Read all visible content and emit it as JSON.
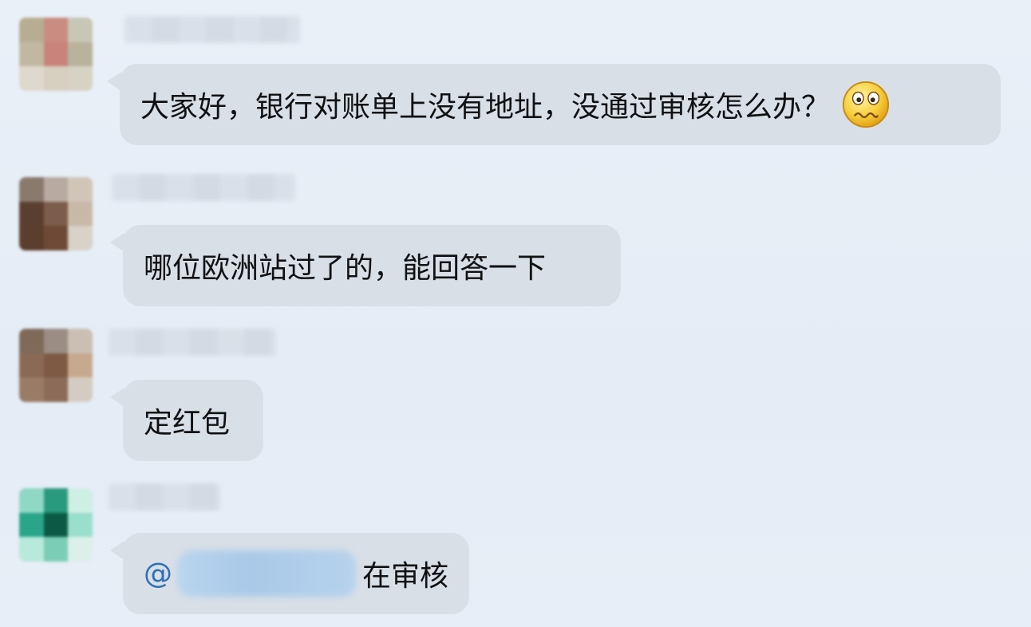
{
  "messages": [
    {
      "text": "大家好，银行对账单上没有地址，没通过审核怎么办？",
      "emoji": "worried-face-icon"
    },
    {
      "text": "哪位欧洲站过了的，能回答一下"
    },
    {
      "text": "定红包"
    },
    {
      "mention_symbol": "@",
      "text": "在审核"
    }
  ],
  "colors": {
    "background": "#e6eef7",
    "bubble": "#d8dfe7",
    "mention": "#2d6fb7"
  }
}
